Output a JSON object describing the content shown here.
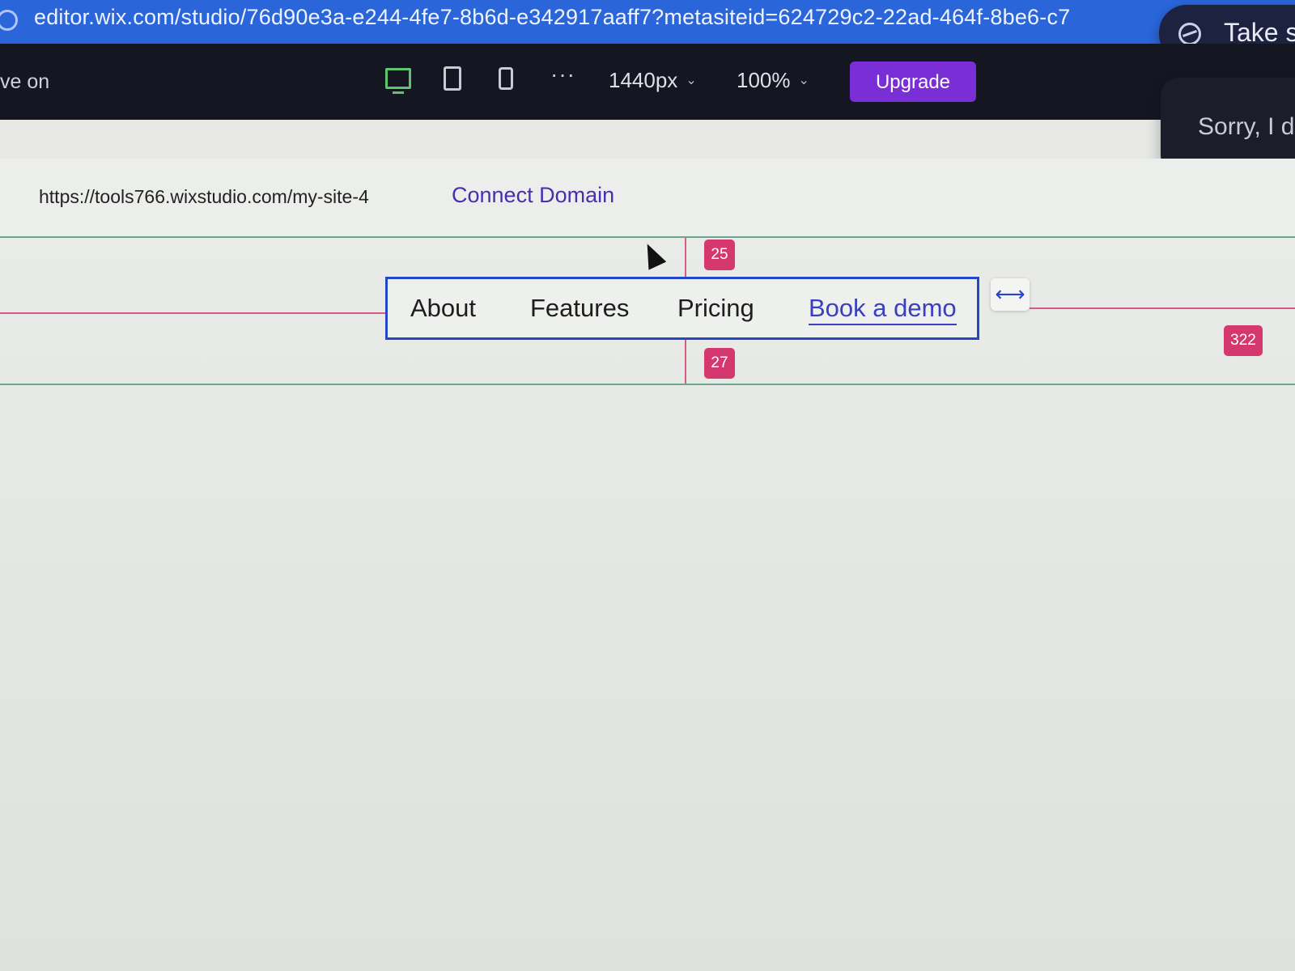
{
  "browser": {
    "url": "editor.wix.com/studio/76d90e3a-e244-4fe7-8b6d-e342917aaff7?metasiteid=624729c2-22ad-464f-8be6-c7",
    "overlay_pill_text": "Take s"
  },
  "topbar": {
    "left_label": "ve on",
    "width_value": "1440px",
    "zoom_value": "100%",
    "upgrade_label": "Upgrade"
  },
  "chat": {
    "text": "Sorry, I d"
  },
  "sitebar": {
    "site_url": "https://tools766.wixstudio.com/my-site-4",
    "connect_label": "Connect Domain"
  },
  "menu": {
    "items": [
      {
        "label": "About",
        "active": false
      },
      {
        "label": "Features",
        "active": false
      },
      {
        "label": "Pricing",
        "active": false
      },
      {
        "label": "Book a demo",
        "active": true
      }
    ]
  },
  "spacing": {
    "top": "25",
    "bottom": "27",
    "right": "322"
  },
  "colors": {
    "accent": "#7a2fd6",
    "selection": "#2447c7",
    "guide": "#d75c8a"
  }
}
